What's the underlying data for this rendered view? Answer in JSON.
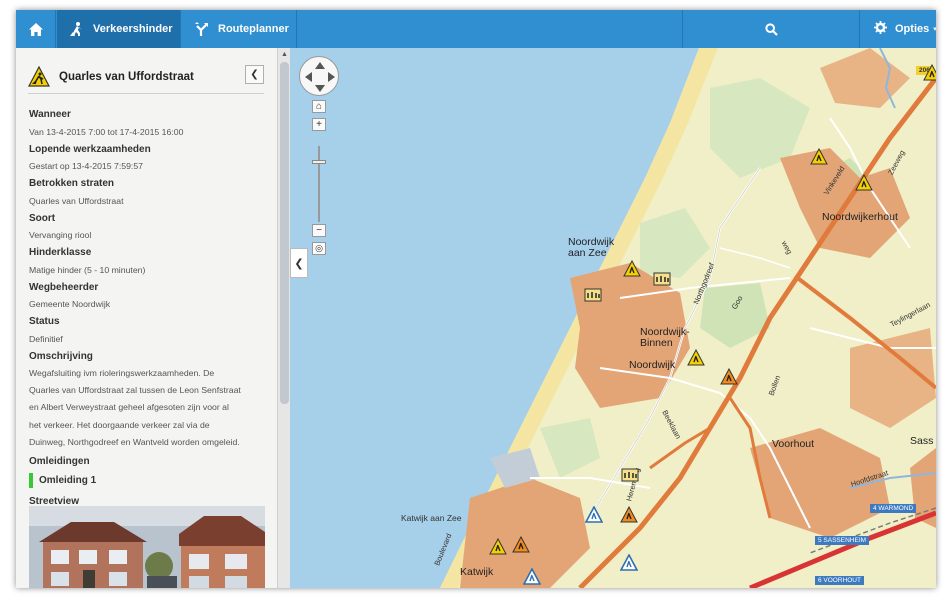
{
  "nav": {
    "tabs": [
      {
        "label": "Verkeershinder",
        "icon": "roadwork-icon"
      },
      {
        "label": "Routeplanner",
        "icon": "route-icon"
      }
    ],
    "options_label": "Opties"
  },
  "panel": {
    "title": "Quarles van Uffordstraat",
    "fields": [
      {
        "label": "Wanneer",
        "value": "Van 13-4-2015 7:00 tot 17-4-2015 16:00"
      },
      {
        "label": "Lopende werkzaamheden",
        "value": "Gestart op 13-4-2015 7:59:57"
      },
      {
        "label": "Betrokken straten",
        "value": "Quarles van Uffordstraat"
      },
      {
        "label": "Soort",
        "value": "Vervanging riool"
      },
      {
        "label": "Hinderklasse",
        "value": "Matige hinder (5 - 10 minuten)"
      },
      {
        "label": "Wegbeheerder",
        "value": "Gemeente Noordwijk"
      },
      {
        "label": "Status",
        "value": "Definitief"
      }
    ],
    "description_label": "Omschrijving",
    "description_lines": [
      "Wegafsluiting ivm rioleringswerkzaamheden. De",
      "Quarles van Uffordstraat zal tussen de Leon Senfstraat",
      "en Albert Verweystraat geheel afgesoten zijn voor al",
      "het verkeer. Het doorgaande verkeer zal via de",
      "Duinweg, Northgodreef en Wantveld worden omgeleid."
    ],
    "detours_label": "Omleidingen",
    "detour_item": "Omleiding 1",
    "streetview_label": "Streetview"
  },
  "map": {
    "places": [
      {
        "name": "Noordwijk aan Zee",
        "lines": [
          "Noordwijk",
          "aan Zee"
        ]
      },
      {
        "name": "Noordwijk-Binnen",
        "lines": [
          "Noordwijk-",
          "Binnen"
        ]
      },
      {
        "name": "Noordwijk"
      },
      {
        "name": "Noordwijkerhout"
      },
      {
        "name": "Voorhout"
      },
      {
        "name": "Katwijk"
      },
      {
        "name": "Katwijk aan Zee"
      },
      {
        "name": "Sass"
      }
    ],
    "streets": [
      "Northgodreef",
      "Goo",
      "Beeklaan",
      "Bollen",
      "Vinkeveld",
      "Zeeweg",
      "Teylingerlaan",
      "Hoofdstraat",
      "Boulevard",
      "Herenweg",
      "weg"
    ],
    "road_signs": [
      "4 WARMOND",
      "5 SASSENHEIM",
      "6 VOORHOUT"
    ],
    "road_number": "206",
    "sea_color": "#a6cfea",
    "land_color": "#f0efc8",
    "built_color": "#e3a576",
    "main_road_color": "#e07b3c"
  }
}
